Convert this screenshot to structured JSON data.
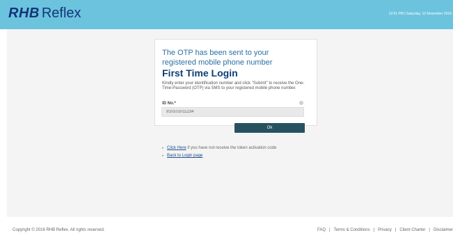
{
  "header": {
    "logo_bold": "RHB",
    "logo_text": "Reflex",
    "datetime": "12:01 PM | Saturday, 12 November 2016"
  },
  "card": {
    "otp_message": "The OTP has been sent to your registered mobile phone number",
    "title": "First Time Login",
    "instructions": "Kindly enter your identification number and click \"Submit\" to receive the One-Time-Password (OTP) via SMS to your registered mobile phone number.",
    "id_label": "ID No.*",
    "id_value": "910101011234",
    "ok_label": "Ok"
  },
  "links": {
    "click_here": "Click Here",
    "click_here_rest": " if you have not receive the token activation code",
    "back_to_login": "Back to Login page"
  },
  "footer": {
    "copyright": "Copyright © 2016 RHB Reflex. All rights reserved.",
    "links": [
      "FAQ",
      "Terms & Conditions",
      "Privacy",
      "Client Charter",
      "Disclaimer"
    ]
  },
  "colors": {
    "header_bg": "#6cc3de",
    "logo": "#12357a",
    "title": "#0e3e72",
    "otp_message": "#2b6fa3",
    "button_bg": "#26525f",
    "link": "#1f4f8a"
  }
}
